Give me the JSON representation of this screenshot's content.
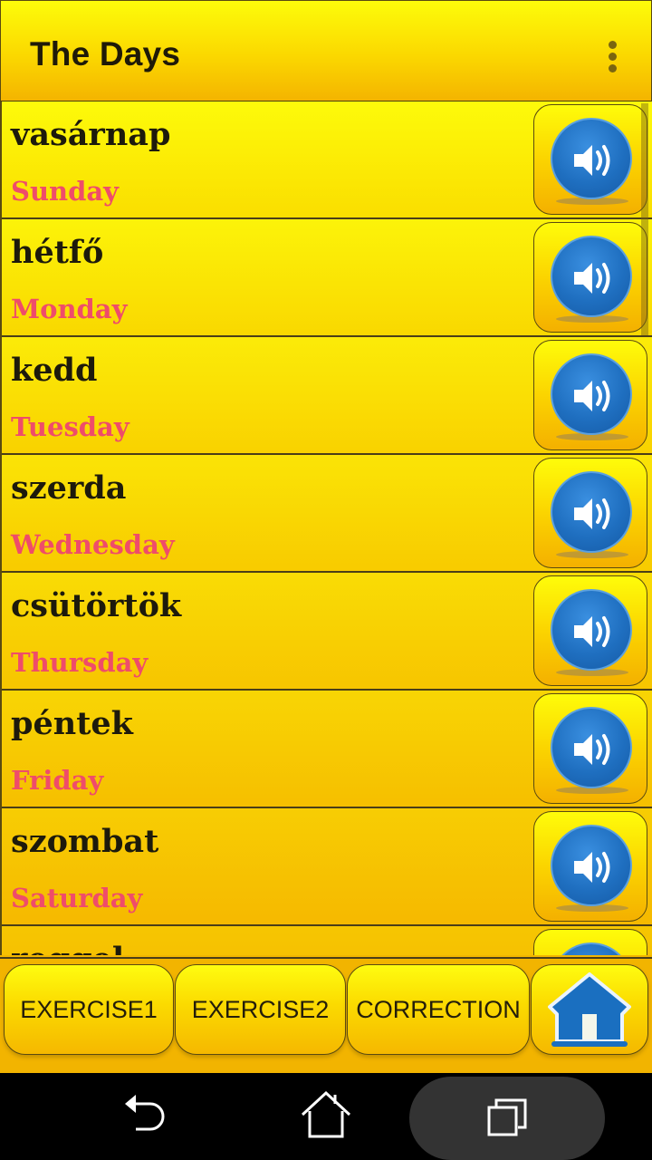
{
  "appbar": {
    "title": "The Days",
    "menu_icon": "more-vert-icon"
  },
  "words": [
    {
      "hungarian": "vasárnap",
      "english": "Sunday"
    },
    {
      "hungarian": "hétfő",
      "english": "Monday"
    },
    {
      "hungarian": "kedd",
      "english": "Tuesday"
    },
    {
      "hungarian": "szerda",
      "english": "Wednesday"
    },
    {
      "hungarian": "csütörtök",
      "english": "Thursday"
    },
    {
      "hungarian": "péntek",
      "english": "Friday"
    },
    {
      "hungarian": "szombat",
      "english": "Saturday"
    },
    {
      "hungarian": "reggel",
      "english": ""
    }
  ],
  "bottom_buttons": {
    "exercise1": "EXERCISE1",
    "exercise2": "EXERCISE2",
    "correction": "CORRECTION",
    "home_icon": "home-icon"
  },
  "colors": {
    "accent_yellow": "#fbd800",
    "english_text": "#ef4c6a",
    "speaker_blue": "#1f6fc0"
  },
  "system_nav": [
    "back",
    "home",
    "recents"
  ]
}
